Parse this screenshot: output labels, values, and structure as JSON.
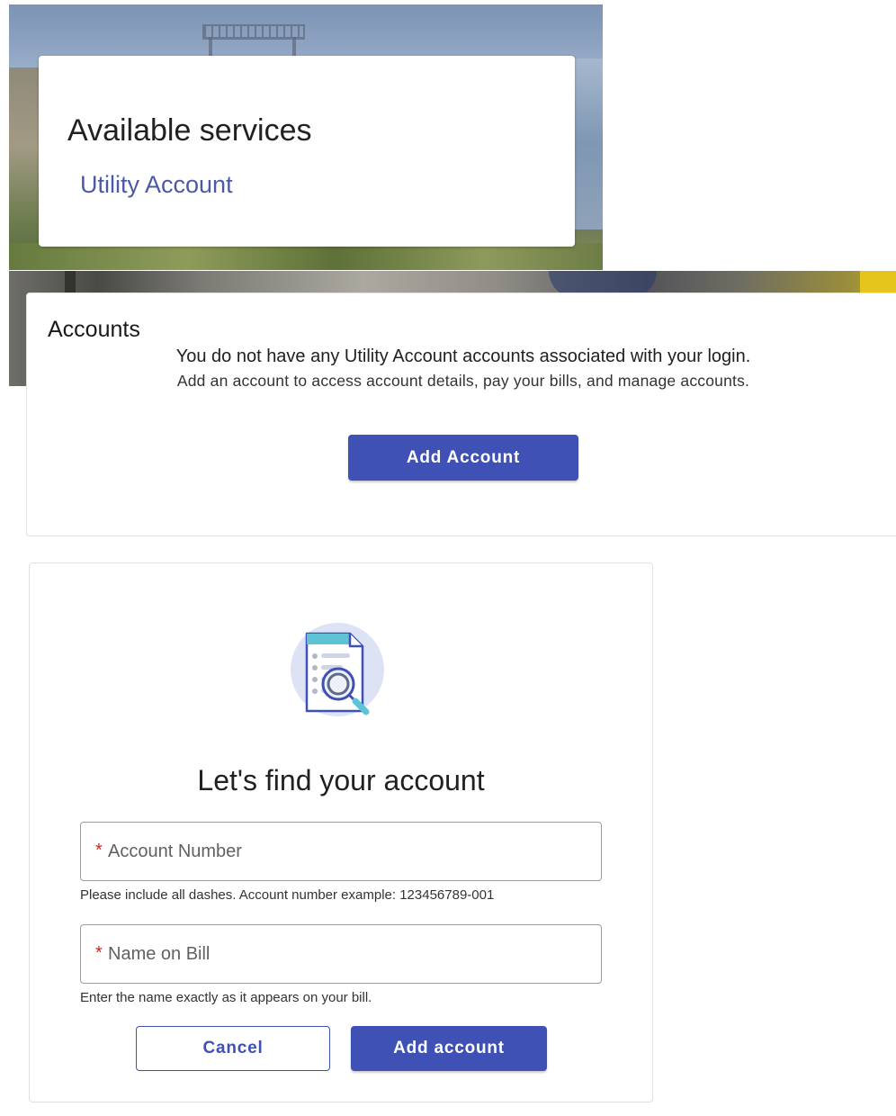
{
  "services": {
    "title": "Available services",
    "link_label": "Utility Account"
  },
  "accounts": {
    "title": "Accounts",
    "message_line_1": "You do not have any Utility Account accounts associated with your login.",
    "message_line_2": "Add an account to access account details, pay your bills, and manage accounts.",
    "add_button_label": "Add Account"
  },
  "find_account": {
    "title": "Let's find your account",
    "account_number": {
      "required_mark": "*",
      "placeholder": "Account Number",
      "value": "",
      "hint": "Please include all dashes. Account number example: 123456789-001"
    },
    "name_on_bill": {
      "required_mark": "*",
      "placeholder": "Name on Bill",
      "value": "",
      "hint": "Enter the name exactly as it appears on your bill."
    },
    "cancel_label": "Cancel",
    "add_label": "Add account",
    "illustration_icon": "document-search-icon"
  },
  "colors": {
    "primary": "#3f51b5",
    "link": "#4b5aa8",
    "required": "#c62828",
    "illustration_circle": "#dde3f5",
    "illustration_header": "#5fc3d6"
  }
}
